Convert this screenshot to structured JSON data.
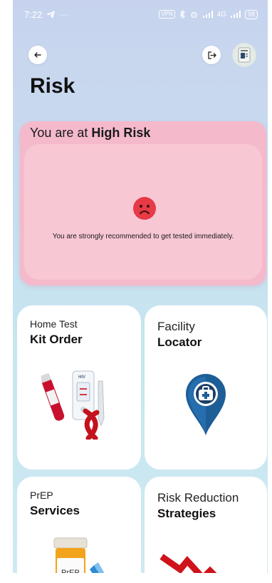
{
  "status_bar": {
    "time": "7:22",
    "dots": "···",
    "vpn": "VPN",
    "network": "4G",
    "battery": "98"
  },
  "page": {
    "title": "Risk"
  },
  "risk_card": {
    "prefix": "You are at ",
    "level": "High Risk",
    "message": "You are strongly recommended to get tested immediately."
  },
  "tiles": [
    {
      "line1": "Home Test",
      "line2": "Kit Order",
      "icon": "hiv-test-kit-icon"
    },
    {
      "line1": "Facility",
      "line2": "Locator",
      "icon": "medical-location-pin-icon"
    },
    {
      "line1": "PrEP",
      "line2": "Services",
      "icon": "prep-pill-bottle-icon",
      "image_label": "PrEP"
    },
    {
      "line1": "Risk Reduction",
      "line2": "Strategies",
      "icon": "downward-trend-arrow-icon"
    }
  ],
  "colors": {
    "risk_card": "#f5b9cc",
    "risk_inner": "#f7c7d4",
    "sad_face": "#e63a46",
    "pin_blue": "#1e5e97"
  }
}
